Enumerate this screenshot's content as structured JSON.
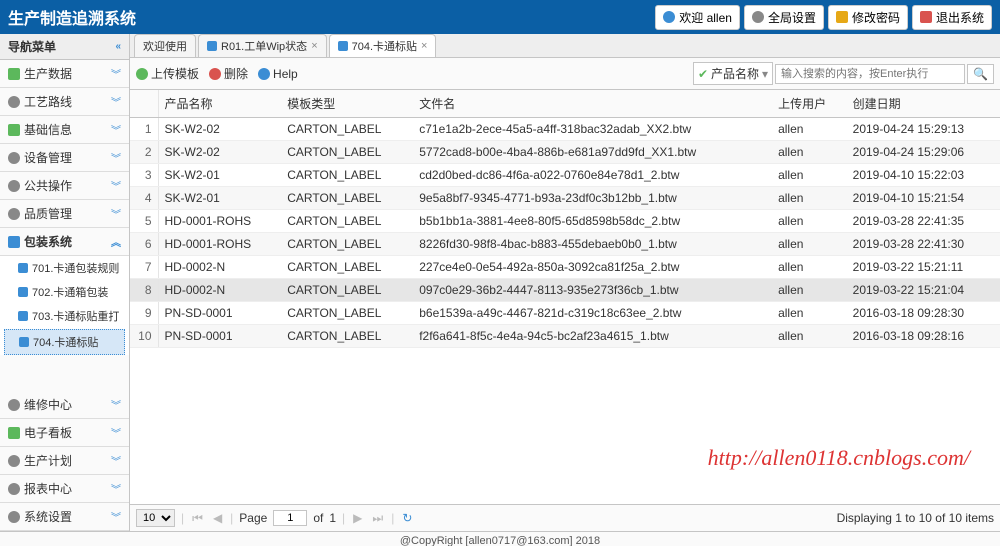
{
  "header": {
    "title": "生产制造追溯系统",
    "welcome": "欢迎 allen",
    "settings": "全局设置",
    "password": "修改密码",
    "logout": "退出系统"
  },
  "sidebar": {
    "title": "导航菜单",
    "items": [
      {
        "label": "生产数据",
        "icon": "green"
      },
      {
        "label": "工艺路线",
        "icon": "dot"
      },
      {
        "label": "基础信息",
        "icon": "green"
      },
      {
        "label": "设备管理",
        "icon": "dot"
      },
      {
        "label": "公共操作",
        "icon": "dot"
      },
      {
        "label": "品质管理",
        "icon": "dot"
      },
      {
        "label": "包装系统",
        "icon": "blue",
        "active": true
      },
      {
        "label": "维修中心",
        "icon": "dot"
      },
      {
        "label": "电子看板",
        "icon": "green"
      },
      {
        "label": "生产计划",
        "icon": "dot"
      },
      {
        "label": "报表中心",
        "icon": "dot"
      },
      {
        "label": "系统设置",
        "icon": "dot"
      }
    ],
    "subitems": [
      {
        "label": "701.卡通包装规则"
      },
      {
        "label": "702.卡通箱包装"
      },
      {
        "label": "703.卡通标贴重打"
      },
      {
        "label": "704.卡通标贴",
        "selected": true
      }
    ]
  },
  "tabs": [
    {
      "label": "欢迎使用",
      "closable": false
    },
    {
      "label": "R01.工单Wip状态",
      "closable": true
    },
    {
      "label": "704.卡通标贴",
      "closable": true,
      "active": true
    }
  ],
  "toolbar": {
    "upload": "上传模板",
    "delete": "删除",
    "help": "Help",
    "filter_field": "产品名称",
    "search_placeholder": "输入搜索的内容，按Enter执行"
  },
  "table": {
    "headers": [
      "产品名称",
      "模板类型",
      "文件名",
      "上传用户",
      "创建日期"
    ],
    "rows": [
      {
        "i": 1,
        "name": "SK-W2-02",
        "type": "CARTON_LABEL",
        "file": "c71e1a2b-2ece-45a5-a4ff-318bac32adab_XX2.btw",
        "user": "allen",
        "date": "2019-04-24 15:29:13"
      },
      {
        "i": 2,
        "name": "SK-W2-02",
        "type": "CARTON_LABEL",
        "file": "5772cad8-b00e-4ba4-886b-e681a97dd9fd_XX1.btw",
        "user": "allen",
        "date": "2019-04-24 15:29:06"
      },
      {
        "i": 3,
        "name": "SK-W2-01",
        "type": "CARTON_LABEL",
        "file": "cd2d0bed-dc86-4f6a-a022-0760e84e78d1_2.btw",
        "user": "allen",
        "date": "2019-04-10 15:22:03"
      },
      {
        "i": 4,
        "name": "SK-W2-01",
        "type": "CARTON_LABEL",
        "file": "9e5a8bf7-9345-4771-b93a-23df0c3b12bb_1.btw",
        "user": "allen",
        "date": "2019-04-10 15:21:54"
      },
      {
        "i": 5,
        "name": "HD-0001-ROHS",
        "type": "CARTON_LABEL",
        "file": "b5b1bb1a-3881-4ee8-80f5-65d8598b58dc_2.btw",
        "user": "allen",
        "date": "2019-03-28 22:41:35"
      },
      {
        "i": 6,
        "name": "HD-0001-ROHS",
        "type": "CARTON_LABEL",
        "file": "8226fd30-98f8-4bac-b883-455debaeb0b0_1.btw",
        "user": "allen",
        "date": "2019-03-28 22:41:30"
      },
      {
        "i": 7,
        "name": "HD-0002-N",
        "type": "CARTON_LABEL",
        "file": "227ce4e0-0e54-492a-850a-3092ca81f25a_2.btw",
        "user": "allen",
        "date": "2019-03-22 15:21:11"
      },
      {
        "i": 8,
        "name": "HD-0002-N",
        "type": "CARTON_LABEL",
        "file": "097c0e29-36b2-4447-8113-935e273f36cb_1.btw",
        "user": "allen",
        "date": "2019-03-22 15:21:04",
        "hov": true
      },
      {
        "i": 9,
        "name": "PN-SD-0001",
        "type": "CARTON_LABEL",
        "file": "b6e1539a-a49c-4467-821d-c319c18c63ee_2.btw",
        "user": "allen",
        "date": "2016-03-18 09:28:30"
      },
      {
        "i": 10,
        "name": "PN-SD-0001",
        "type": "CARTON_LABEL",
        "file": "f2f6a641-8f5c-4e4a-94c5-bc2af23a4615_1.btw",
        "user": "allen",
        "date": "2016-03-18 09:28:16"
      }
    ]
  },
  "pager": {
    "page_size": "10",
    "page_label": "Page",
    "page": "1",
    "of": "of",
    "total_pages": "1",
    "summary": "Displaying 1 to 10 of 10 items"
  },
  "footer": "@CopyRight [allen0717@163.com] 2018",
  "watermark": "http://allen0118.cnblogs.com/"
}
